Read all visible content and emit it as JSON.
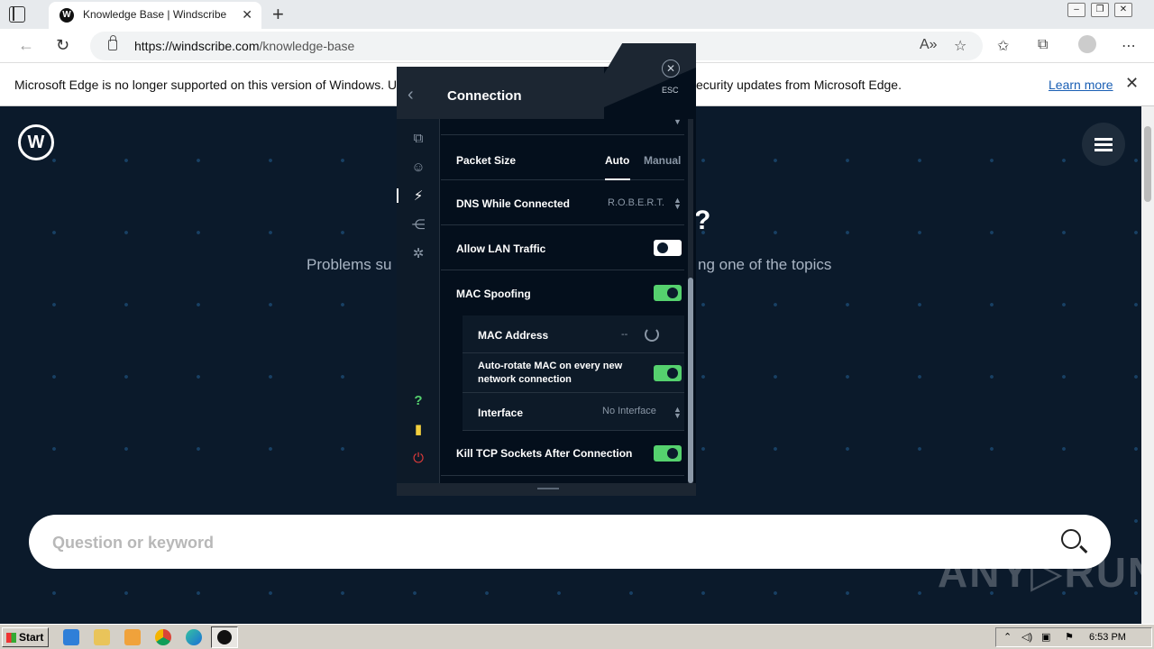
{
  "browser": {
    "tab_title": "Knowledge Base | Windscribe",
    "favicon_letter": "W",
    "url_host": "https://windscribe.com",
    "url_path": "/knowledge-base",
    "win_minimize": "–",
    "win_restore": "❐",
    "win_close": "✕"
  },
  "infobar": {
    "message_left": "Microsoft Edge is no longer supported on this version of Windows. Upg",
    "message_right": "ecurity updates from Microsoft Edge.",
    "learn_more": "Learn more"
  },
  "page": {
    "logo_letter": "W",
    "heading_visible": "?",
    "subtitle_left": "Problems su",
    "subtitle_right": "ng one of the topics",
    "search_placeholder": "Question or keyword",
    "watermark": "ANY▷RUN"
  },
  "windscribe": {
    "title": "Connection",
    "esc_label": "ESC",
    "rows": {
      "packet_size": {
        "label": "Packet Size",
        "option_auto": "Auto",
        "option_manual": "Manual",
        "selected": "Auto"
      },
      "dns_while_connected": {
        "label": "DNS While Connected",
        "value": "R.O.B.E.R.T."
      },
      "allow_lan_traffic": {
        "label": "Allow LAN Traffic",
        "enabled": false
      },
      "mac_spoofing": {
        "label": "MAC Spoofing",
        "enabled": true
      },
      "mac_address": {
        "label": "MAC Address",
        "value": "--"
      },
      "auto_rotate_mac": {
        "label_line1": "Auto-rotate MAC on every new",
        "label_line2": "network connection",
        "enabled": true
      },
      "interface": {
        "label": "Interface",
        "value": "No Interface"
      },
      "kill_tcp_sockets": {
        "label": "Kill TCP Sockets After Connection",
        "enabled": true
      }
    },
    "sidebar_icons": [
      "general-icon",
      "account-icon",
      "connection-icon",
      "share-icon",
      "debug-icon",
      "help-icon",
      "about-icon",
      "quit-icon"
    ],
    "colors": {
      "toggle_on": "#55d16e",
      "panel_bg": "#040f1c",
      "quit": "#e03b3b",
      "help": "#55d16e",
      "about": "#f3d03e"
    }
  },
  "taskbar": {
    "start_label": "Start",
    "clock": "6:53 PM"
  }
}
